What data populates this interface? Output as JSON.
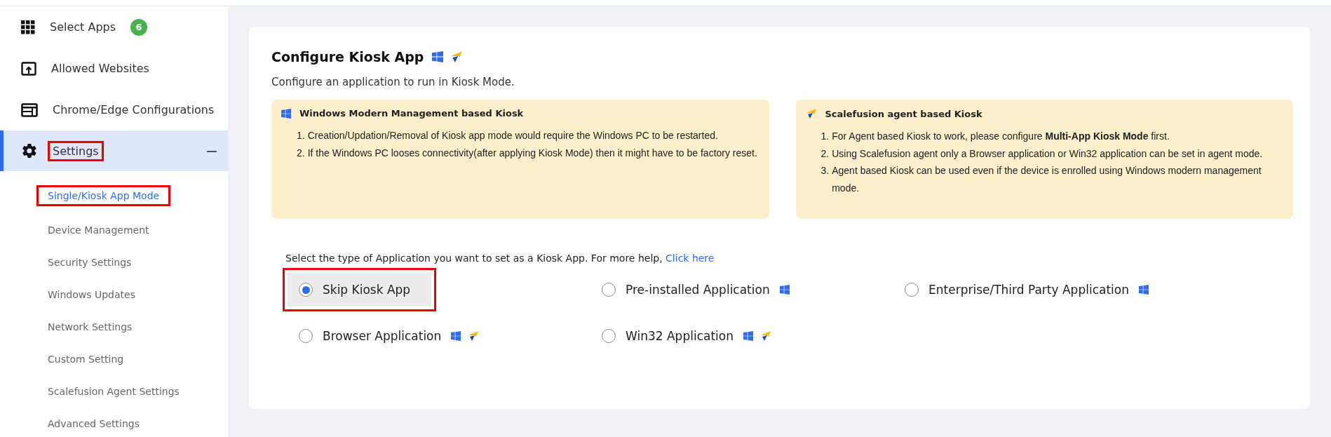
{
  "sidebar": {
    "items": [
      {
        "label": "Select Apps",
        "kind": "grid",
        "badge": "6"
      },
      {
        "label": "Allowed Websites",
        "kind": "upload-window"
      },
      {
        "label": "Chrome/Edge Configurations",
        "kind": "browser-window"
      },
      {
        "label": "Settings",
        "kind": "gear",
        "selected": true,
        "expanded": true,
        "annotated": true,
        "children": [
          {
            "label": "Single/Kiosk App Mode",
            "selected": true,
            "annotated": true
          },
          {
            "label": "Device Management",
            "selected": false,
            "annotated": false
          },
          {
            "label": "Security Settings",
            "selected": false,
            "annotated": false
          },
          {
            "label": "Windows Updates",
            "selected": false,
            "annotated": false
          },
          {
            "label": "Network Settings",
            "selected": false,
            "annotated": false
          },
          {
            "label": "Custom Setting",
            "selected": false,
            "annotated": false
          },
          {
            "label": "Scalefusion Agent Settings",
            "selected": false,
            "annotated": false
          },
          {
            "label": "Advanced Settings",
            "selected": false,
            "annotated": false
          }
        ]
      }
    ]
  },
  "main": {
    "title": "Configure Kiosk App",
    "title_badges": [
      {
        "kind": "windows"
      },
      {
        "kind": "agent"
      }
    ],
    "subtitle": "Configure an application to run in Kiosk Mode.",
    "notes": [
      {
        "kind": "windows",
        "title": "Windows Modern Management based Kiosk",
        "items": [
          {
            "number": "1.",
            "text": "Creation/Updation/Removal of Kiosk app mode would require the Windows PC to be restarted."
          },
          {
            "number": "2.",
            "text": "If the Windows PC looses connectivity(after applying Kiosk Mode) then it might have to be factory reset."
          }
        ]
      },
      {
        "kind": "agent",
        "title": "Scalefusion agent based Kiosk",
        "items": [
          {
            "number": "1.",
            "text": "For Agent based Kiosk to work, please configure **Multi-App Kiosk Mode** first."
          },
          {
            "number": "2.",
            "text": "Using Scalefusion agent only a Browser application or Win32 application can be set in agent mode."
          },
          {
            "number": "3.",
            "text": "Agent based Kiosk can be used even if the device is enrolled using Windows modern management mode."
          }
        ]
      }
    ],
    "prompt": "Select the type of Application you want to set as a Kiosk App. For more help,",
    "help_link": "Click here",
    "options": [
      {
        "label": "Skip Kiosk App",
        "selected": true,
        "annotated": true
      },
      {
        "label": "Pre-installed Application",
        "selected": false,
        "annotated": false,
        "badges": [
          {
            "kind": "windows"
          }
        ]
      },
      {
        "label": "Enterprise/Third Party Application",
        "selected": false,
        "annotated": false,
        "badges": [
          {
            "kind": "windows"
          }
        ]
      },
      {
        "label": "Browser Application",
        "selected": false,
        "annotated": false,
        "badges": [
          {
            "kind": "windows"
          },
          {
            "kind": "agent"
          }
        ]
      },
      {
        "label": "Win32 Application",
        "selected": false,
        "annotated": false,
        "badges": [
          {
            "kind": "windows"
          },
          {
            "kind": "agent"
          }
        ]
      }
    ]
  }
}
